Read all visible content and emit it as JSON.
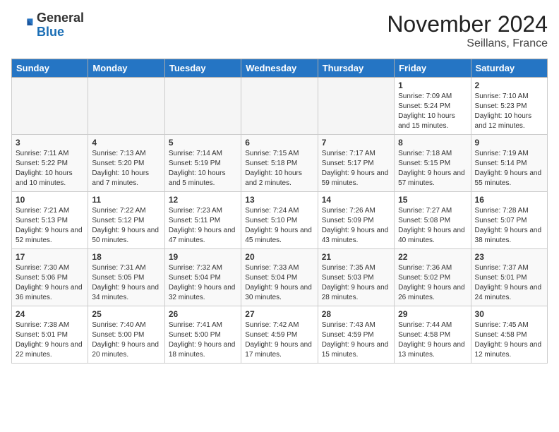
{
  "logo": {
    "general": "General",
    "blue": "Blue"
  },
  "title": "November 2024",
  "subtitle": "Seillans, France",
  "days_of_week": [
    "Sunday",
    "Monday",
    "Tuesday",
    "Wednesday",
    "Thursday",
    "Friday",
    "Saturday"
  ],
  "weeks": [
    [
      {
        "day": "",
        "info": ""
      },
      {
        "day": "",
        "info": ""
      },
      {
        "day": "",
        "info": ""
      },
      {
        "day": "",
        "info": ""
      },
      {
        "day": "",
        "info": ""
      },
      {
        "day": "1",
        "info": "Sunrise: 7:09 AM\nSunset: 5:24 PM\nDaylight: 10 hours and 15 minutes."
      },
      {
        "day": "2",
        "info": "Sunrise: 7:10 AM\nSunset: 5:23 PM\nDaylight: 10 hours and 12 minutes."
      }
    ],
    [
      {
        "day": "3",
        "info": "Sunrise: 7:11 AM\nSunset: 5:22 PM\nDaylight: 10 hours and 10 minutes."
      },
      {
        "day": "4",
        "info": "Sunrise: 7:13 AM\nSunset: 5:20 PM\nDaylight: 10 hours and 7 minutes."
      },
      {
        "day": "5",
        "info": "Sunrise: 7:14 AM\nSunset: 5:19 PM\nDaylight: 10 hours and 5 minutes."
      },
      {
        "day": "6",
        "info": "Sunrise: 7:15 AM\nSunset: 5:18 PM\nDaylight: 10 hours and 2 minutes."
      },
      {
        "day": "7",
        "info": "Sunrise: 7:17 AM\nSunset: 5:17 PM\nDaylight: 9 hours and 59 minutes."
      },
      {
        "day": "8",
        "info": "Sunrise: 7:18 AM\nSunset: 5:15 PM\nDaylight: 9 hours and 57 minutes."
      },
      {
        "day": "9",
        "info": "Sunrise: 7:19 AM\nSunset: 5:14 PM\nDaylight: 9 hours and 55 minutes."
      }
    ],
    [
      {
        "day": "10",
        "info": "Sunrise: 7:21 AM\nSunset: 5:13 PM\nDaylight: 9 hours and 52 minutes."
      },
      {
        "day": "11",
        "info": "Sunrise: 7:22 AM\nSunset: 5:12 PM\nDaylight: 9 hours and 50 minutes."
      },
      {
        "day": "12",
        "info": "Sunrise: 7:23 AM\nSunset: 5:11 PM\nDaylight: 9 hours and 47 minutes."
      },
      {
        "day": "13",
        "info": "Sunrise: 7:24 AM\nSunset: 5:10 PM\nDaylight: 9 hours and 45 minutes."
      },
      {
        "day": "14",
        "info": "Sunrise: 7:26 AM\nSunset: 5:09 PM\nDaylight: 9 hours and 43 minutes."
      },
      {
        "day": "15",
        "info": "Sunrise: 7:27 AM\nSunset: 5:08 PM\nDaylight: 9 hours and 40 minutes."
      },
      {
        "day": "16",
        "info": "Sunrise: 7:28 AM\nSunset: 5:07 PM\nDaylight: 9 hours and 38 minutes."
      }
    ],
    [
      {
        "day": "17",
        "info": "Sunrise: 7:30 AM\nSunset: 5:06 PM\nDaylight: 9 hours and 36 minutes."
      },
      {
        "day": "18",
        "info": "Sunrise: 7:31 AM\nSunset: 5:05 PM\nDaylight: 9 hours and 34 minutes."
      },
      {
        "day": "19",
        "info": "Sunrise: 7:32 AM\nSunset: 5:04 PM\nDaylight: 9 hours and 32 minutes."
      },
      {
        "day": "20",
        "info": "Sunrise: 7:33 AM\nSunset: 5:04 PM\nDaylight: 9 hours and 30 minutes."
      },
      {
        "day": "21",
        "info": "Sunrise: 7:35 AM\nSunset: 5:03 PM\nDaylight: 9 hours and 28 minutes."
      },
      {
        "day": "22",
        "info": "Sunrise: 7:36 AM\nSunset: 5:02 PM\nDaylight: 9 hours and 26 minutes."
      },
      {
        "day": "23",
        "info": "Sunrise: 7:37 AM\nSunset: 5:01 PM\nDaylight: 9 hours and 24 minutes."
      }
    ],
    [
      {
        "day": "24",
        "info": "Sunrise: 7:38 AM\nSunset: 5:01 PM\nDaylight: 9 hours and 22 minutes."
      },
      {
        "day": "25",
        "info": "Sunrise: 7:40 AM\nSunset: 5:00 PM\nDaylight: 9 hours and 20 minutes."
      },
      {
        "day": "26",
        "info": "Sunrise: 7:41 AM\nSunset: 5:00 PM\nDaylight: 9 hours and 18 minutes."
      },
      {
        "day": "27",
        "info": "Sunrise: 7:42 AM\nSunset: 4:59 PM\nDaylight: 9 hours and 17 minutes."
      },
      {
        "day": "28",
        "info": "Sunrise: 7:43 AM\nSunset: 4:59 PM\nDaylight: 9 hours and 15 minutes."
      },
      {
        "day": "29",
        "info": "Sunrise: 7:44 AM\nSunset: 4:58 PM\nDaylight: 9 hours and 13 minutes."
      },
      {
        "day": "30",
        "info": "Sunrise: 7:45 AM\nSunset: 4:58 PM\nDaylight: 9 hours and 12 minutes."
      }
    ]
  ]
}
